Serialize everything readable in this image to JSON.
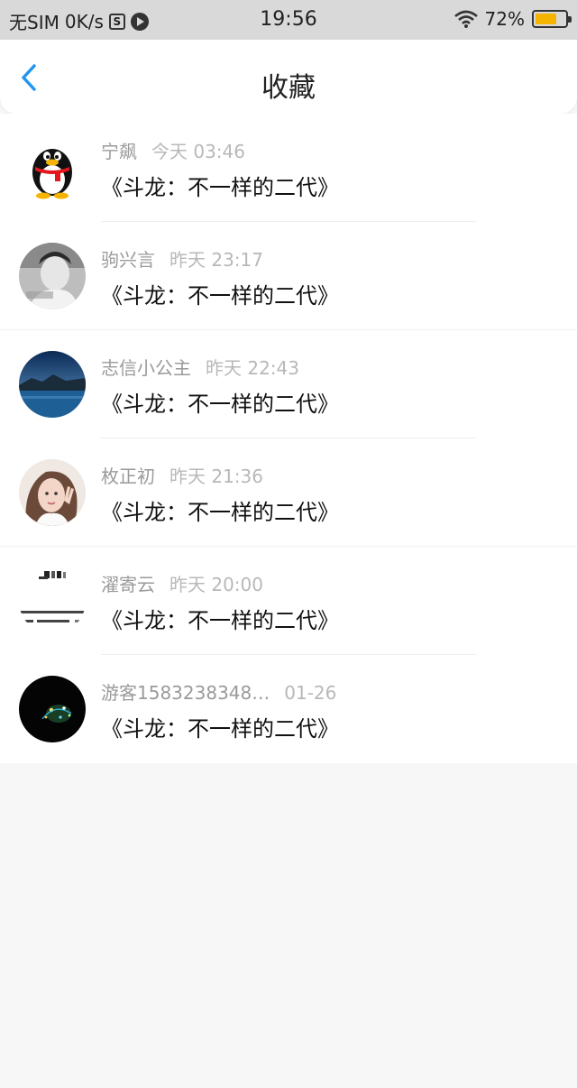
{
  "status": {
    "carrier": "无SIM",
    "speed": "0K/s",
    "box_icon_text": "S",
    "time": "19:56",
    "battery": "72%",
    "battery_level": 0.72,
    "battery_color": "#f5b400"
  },
  "header": {
    "title": "收藏",
    "back_icon": "chevron-left-icon",
    "accent": "#2196f3"
  },
  "favorites": [
    {
      "user": "宁飙",
      "time": "今天 03:46",
      "title": "《斗龙：不一样的二代》",
      "avatar": "qq-penguin-avatar"
    },
    {
      "user": "驹兴言",
      "time": "昨天 23:17",
      "title": "《斗龙：不一样的二代》",
      "avatar": "grayscale-portrait-avatar"
    },
    {
      "user": "志信小公主",
      "time": "昨天 22:43",
      "title": "《斗龙：不一样的二代》",
      "avatar": "lake-landscape-avatar"
    },
    {
      "user": "枚正初",
      "time": "昨天 21:36",
      "title": "《斗龙：不一样的二代》",
      "avatar": "girl-selfie-avatar"
    },
    {
      "user": "濯寄云",
      "time": "昨天 20:00",
      "title": "《斗龙：不一样的二代》",
      "avatar": "text-meme-avatar"
    },
    {
      "user": "游客1583238348…",
      "time": "01-26",
      "title": "《斗龙：不一样的二代》",
      "avatar": "night-lights-avatar"
    }
  ]
}
